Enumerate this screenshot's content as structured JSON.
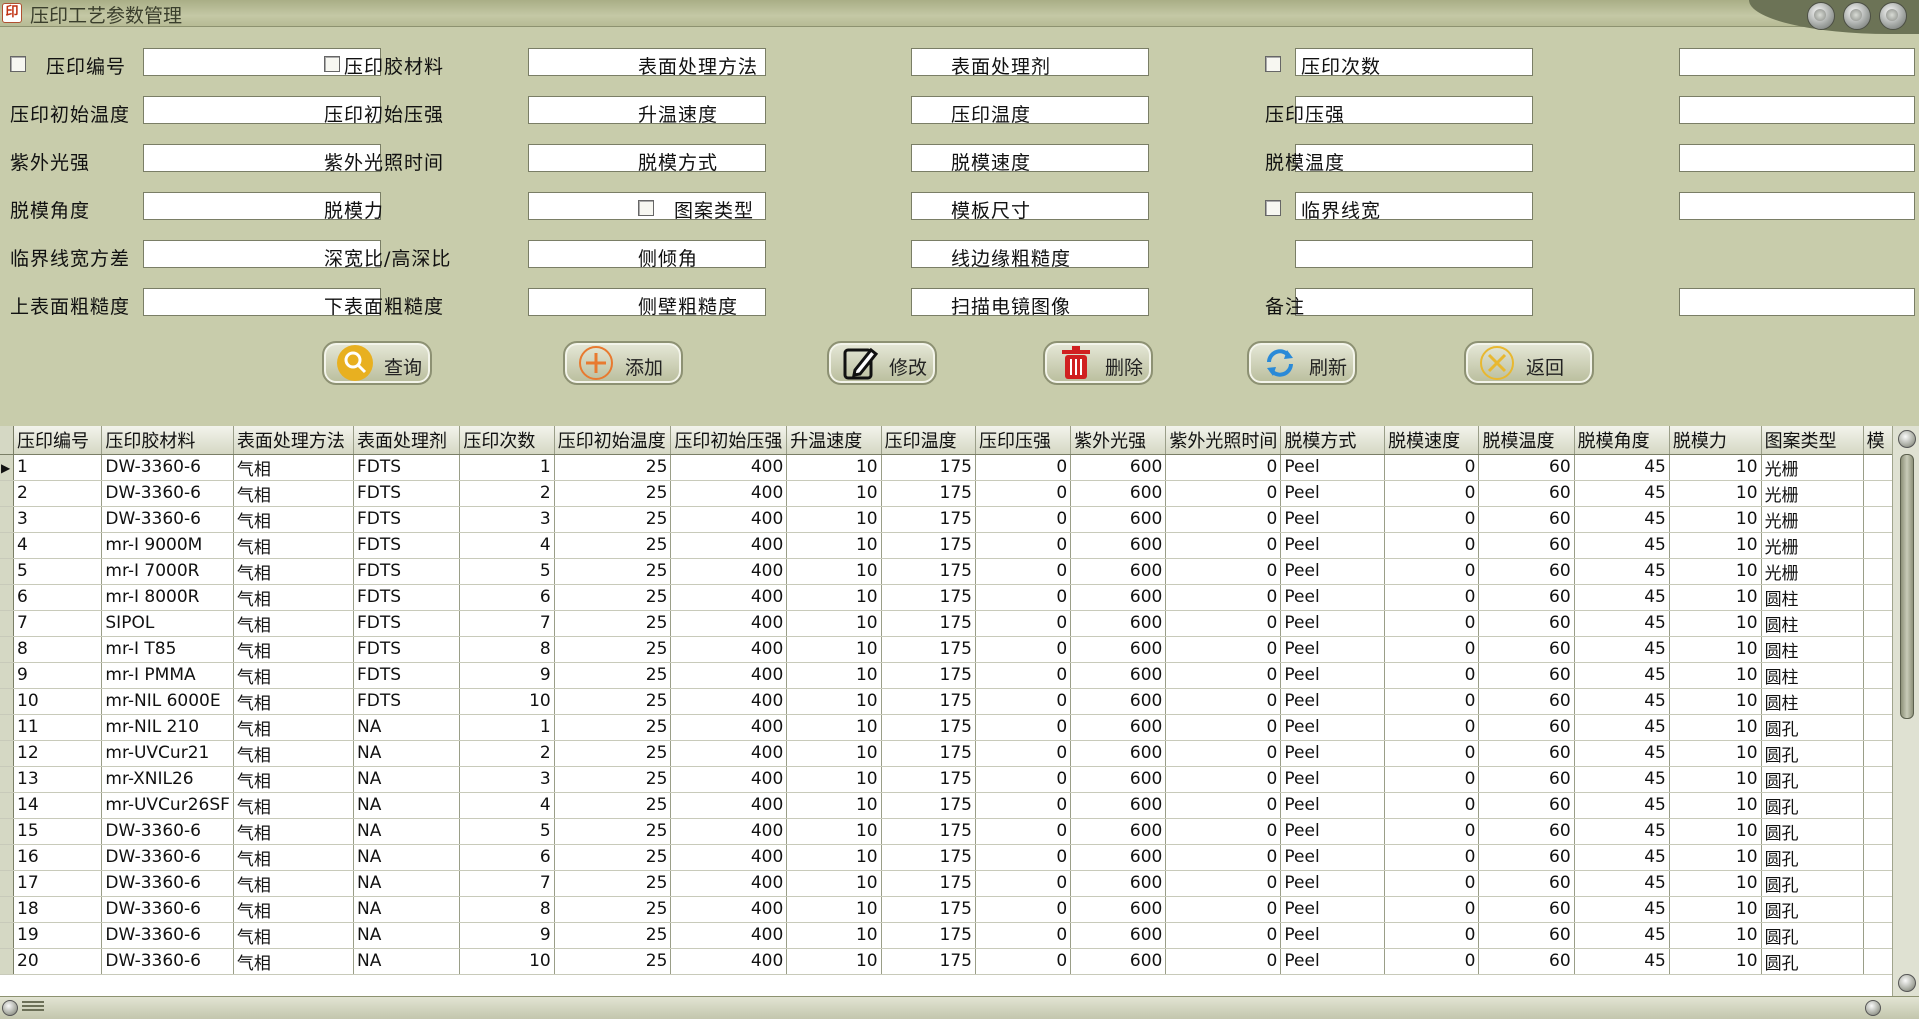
{
  "window": {
    "title": "压印工艺参数管理"
  },
  "form": [
    [
      {
        "label": "压印编号",
        "checkbox": true,
        "value": ""
      },
      {
        "label": "压印胶材料",
        "checkbox": true,
        "value": ""
      },
      {
        "label": "表面处理方法",
        "checkbox": false,
        "value": ""
      },
      {
        "label": "表面处理剂",
        "checkbox": false,
        "value": ""
      },
      {
        "label": "压印次数",
        "checkbox": true,
        "value": ""
      }
    ],
    [
      {
        "label": "压印初始温度",
        "checkbox": false,
        "value": ""
      },
      {
        "label": "压印初始压强",
        "checkbox": false,
        "value": ""
      },
      {
        "label": "升温速度",
        "checkbox": false,
        "value": ""
      },
      {
        "label": "压印温度",
        "checkbox": false,
        "value": ""
      },
      {
        "label": "压印压强",
        "checkbox": false,
        "value": ""
      }
    ],
    [
      {
        "label": "紫外光强",
        "checkbox": false,
        "value": ""
      },
      {
        "label": "紫外光照时间",
        "checkbox": false,
        "value": ""
      },
      {
        "label": "脱模方式",
        "checkbox": false,
        "value": ""
      },
      {
        "label": "脱模速度",
        "checkbox": false,
        "value": ""
      },
      {
        "label": "脱模温度",
        "checkbox": false,
        "value": ""
      }
    ],
    [
      {
        "label": "脱模角度",
        "checkbox": false,
        "value": ""
      },
      {
        "label": "脱模力",
        "checkbox": false,
        "value": ""
      },
      {
        "label": "图案类型",
        "checkbox": true,
        "value": ""
      },
      {
        "label": "模板尺寸",
        "checkbox": false,
        "value": ""
      },
      {
        "label": "临界线宽",
        "checkbox": true,
        "value": ""
      }
    ],
    [
      {
        "label": "临界线宽方差",
        "checkbox": false,
        "value": ""
      },
      {
        "label": "深宽比/高深比",
        "checkbox": false,
        "value": ""
      },
      {
        "label": "侧倾角",
        "checkbox": false,
        "value": ""
      },
      {
        "label": "线边缘粗糙度",
        "checkbox": false,
        "value": ""
      },
      null
    ],
    [
      {
        "label": "上表面粗糙度",
        "checkbox": false,
        "value": ""
      },
      {
        "label": "下表面粗糙度",
        "checkbox": false,
        "value": ""
      },
      {
        "label": "侧壁粗糙度",
        "checkbox": false,
        "value": ""
      },
      {
        "label": "扫描电镜图像",
        "checkbox": false,
        "value": ""
      },
      {
        "label": "备注",
        "checkbox": false,
        "value": ""
      }
    ]
  ],
  "actions": [
    {
      "id": "query",
      "label": "查询",
      "icon": "magnifier-icon",
      "color": "#e8b020"
    },
    {
      "id": "add",
      "label": "添加",
      "icon": "plus-circle-icon",
      "color": "#e87a30"
    },
    {
      "id": "edit",
      "label": "修改",
      "icon": "pencil-icon",
      "color": "#111111"
    },
    {
      "id": "delete",
      "label": "删除",
      "icon": "trash-icon",
      "color": "#d02020"
    },
    {
      "id": "refresh",
      "label": "刷新",
      "icon": "refresh-icon",
      "color": "#2a8ad8"
    },
    {
      "id": "back",
      "label": "返回",
      "icon": "close-circle-icon",
      "color": "#e8b830"
    }
  ],
  "grid": {
    "columns": [
      {
        "label": "压印编号",
        "align": "left"
      },
      {
        "label": "压印胶材料",
        "align": "left"
      },
      {
        "label": "表面处理方法",
        "align": "left"
      },
      {
        "label": "表面处理剂",
        "align": "left"
      },
      {
        "label": "压印次数",
        "align": "right"
      },
      {
        "label": "压印初始温度",
        "align": "right"
      },
      {
        "label": "压印初始压强",
        "align": "right"
      },
      {
        "label": "升温速度",
        "align": "right"
      },
      {
        "label": "压印温度",
        "align": "right"
      },
      {
        "label": "压印压强",
        "align": "right"
      },
      {
        "label": "紫外光强",
        "align": "right"
      },
      {
        "label": "紫外光照时间",
        "align": "right"
      },
      {
        "label": "脱模方式",
        "align": "left"
      },
      {
        "label": "脱模速度",
        "align": "right"
      },
      {
        "label": "脱模温度",
        "align": "right"
      },
      {
        "label": "脱模角度",
        "align": "right"
      },
      {
        "label": "脱模力",
        "align": "right"
      },
      {
        "label": "图案类型",
        "align": "left"
      },
      {
        "label": "模",
        "align": "left"
      }
    ],
    "rows": [
      [
        "1",
        "DW-3360-6",
        "气相",
        "FDTS",
        "1",
        "25",
        "400",
        "10",
        "175",
        "0",
        "600",
        "0",
        "Peel",
        "0",
        "60",
        "45",
        "10",
        "光栅",
        ""
      ],
      [
        "2",
        "DW-3360-6",
        "气相",
        "FDTS",
        "2",
        "25",
        "400",
        "10",
        "175",
        "0",
        "600",
        "0",
        "Peel",
        "0",
        "60",
        "45",
        "10",
        "光栅",
        ""
      ],
      [
        "3",
        "DW-3360-6",
        "气相",
        "FDTS",
        "3",
        "25",
        "400",
        "10",
        "175",
        "0",
        "600",
        "0",
        "Peel",
        "0",
        "60",
        "45",
        "10",
        "光栅",
        ""
      ],
      [
        "4",
        "mr-I 9000M",
        "气相",
        "FDTS",
        "4",
        "25",
        "400",
        "10",
        "175",
        "0",
        "600",
        "0",
        "Peel",
        "0",
        "60",
        "45",
        "10",
        "光栅",
        ""
      ],
      [
        "5",
        "mr-I 7000R",
        "气相",
        "FDTS",
        "5",
        "25",
        "400",
        "10",
        "175",
        "0",
        "600",
        "0",
        "Peel",
        "0",
        "60",
        "45",
        "10",
        "光栅",
        ""
      ],
      [
        "6",
        "mr-I 8000R",
        "气相",
        "FDTS",
        "6",
        "25",
        "400",
        "10",
        "175",
        "0",
        "600",
        "0",
        "Peel",
        "0",
        "60",
        "45",
        "10",
        "圆柱",
        ""
      ],
      [
        "7",
        "SIPOL",
        "气相",
        "FDTS",
        "7",
        "25",
        "400",
        "10",
        "175",
        "0",
        "600",
        "0",
        "Peel",
        "0",
        "60",
        "45",
        "10",
        "圆柱",
        ""
      ],
      [
        "8",
        "mr-I T85",
        "气相",
        "FDTS",
        "8",
        "25",
        "400",
        "10",
        "175",
        "0",
        "600",
        "0",
        "Peel",
        "0",
        "60",
        "45",
        "10",
        "圆柱",
        ""
      ],
      [
        "9",
        "mr-I PMMA",
        "气相",
        "FDTS",
        "9",
        "25",
        "400",
        "10",
        "175",
        "0",
        "600",
        "0",
        "Peel",
        "0",
        "60",
        "45",
        "10",
        "圆柱",
        ""
      ],
      [
        "10",
        "mr-NIL 6000E",
        "气相",
        "FDTS",
        "10",
        "25",
        "400",
        "10",
        "175",
        "0",
        "600",
        "0",
        "Peel",
        "0",
        "60",
        "45",
        "10",
        "圆柱",
        ""
      ],
      [
        "11",
        "mr-NIL 210",
        "气相",
        "NA",
        "1",
        "25",
        "400",
        "10",
        "175",
        "0",
        "600",
        "0",
        "Peel",
        "0",
        "60",
        "45",
        "10",
        "圆孔",
        ""
      ],
      [
        "12",
        "mr-UVCur21",
        "气相",
        "NA",
        "2",
        "25",
        "400",
        "10",
        "175",
        "0",
        "600",
        "0",
        "Peel",
        "0",
        "60",
        "45",
        "10",
        "圆孔",
        ""
      ],
      [
        "13",
        "mr-XNIL26",
        "气相",
        "NA",
        "3",
        "25",
        "400",
        "10",
        "175",
        "0",
        "600",
        "0",
        "Peel",
        "0",
        "60",
        "45",
        "10",
        "圆孔",
        ""
      ],
      [
        "14",
        "mr-UVCur26SF",
        "气相",
        "NA",
        "4",
        "25",
        "400",
        "10",
        "175",
        "0",
        "600",
        "0",
        "Peel",
        "0",
        "60",
        "45",
        "10",
        "圆孔",
        ""
      ],
      [
        "15",
        "DW-3360-6",
        "气相",
        "NA",
        "5",
        "25",
        "400",
        "10",
        "175",
        "0",
        "600",
        "0",
        "Peel",
        "0",
        "60",
        "45",
        "10",
        "圆孔",
        ""
      ],
      [
        "16",
        "DW-3360-6",
        "气相",
        "NA",
        "6",
        "25",
        "400",
        "10",
        "175",
        "0",
        "600",
        "0",
        "Peel",
        "0",
        "60",
        "45",
        "10",
        "圆孔",
        ""
      ],
      [
        "17",
        "DW-3360-6",
        "气相",
        "NA",
        "7",
        "25",
        "400",
        "10",
        "175",
        "0",
        "600",
        "0",
        "Peel",
        "0",
        "60",
        "45",
        "10",
        "圆孔",
        ""
      ],
      [
        "18",
        "DW-3360-6",
        "气相",
        "NA",
        "8",
        "25",
        "400",
        "10",
        "175",
        "0",
        "600",
        "0",
        "Peel",
        "0",
        "60",
        "45",
        "10",
        "圆孔",
        ""
      ],
      [
        "19",
        "DW-3360-6",
        "气相",
        "NA",
        "9",
        "25",
        "400",
        "10",
        "175",
        "0",
        "600",
        "0",
        "Peel",
        "0",
        "60",
        "45",
        "10",
        "圆孔",
        ""
      ],
      [
        "20",
        "DW-3360-6",
        "气相",
        "NA",
        "10",
        "25",
        "400",
        "10",
        "175",
        "0",
        "600",
        "0",
        "Peel",
        "0",
        "60",
        "45",
        "10",
        "圆孔",
        ""
      ]
    ],
    "current_row": 0
  },
  "colors": {
    "background": "#c8ccab",
    "grid_header": "#d5d8c4",
    "border": "#7a7e66"
  }
}
